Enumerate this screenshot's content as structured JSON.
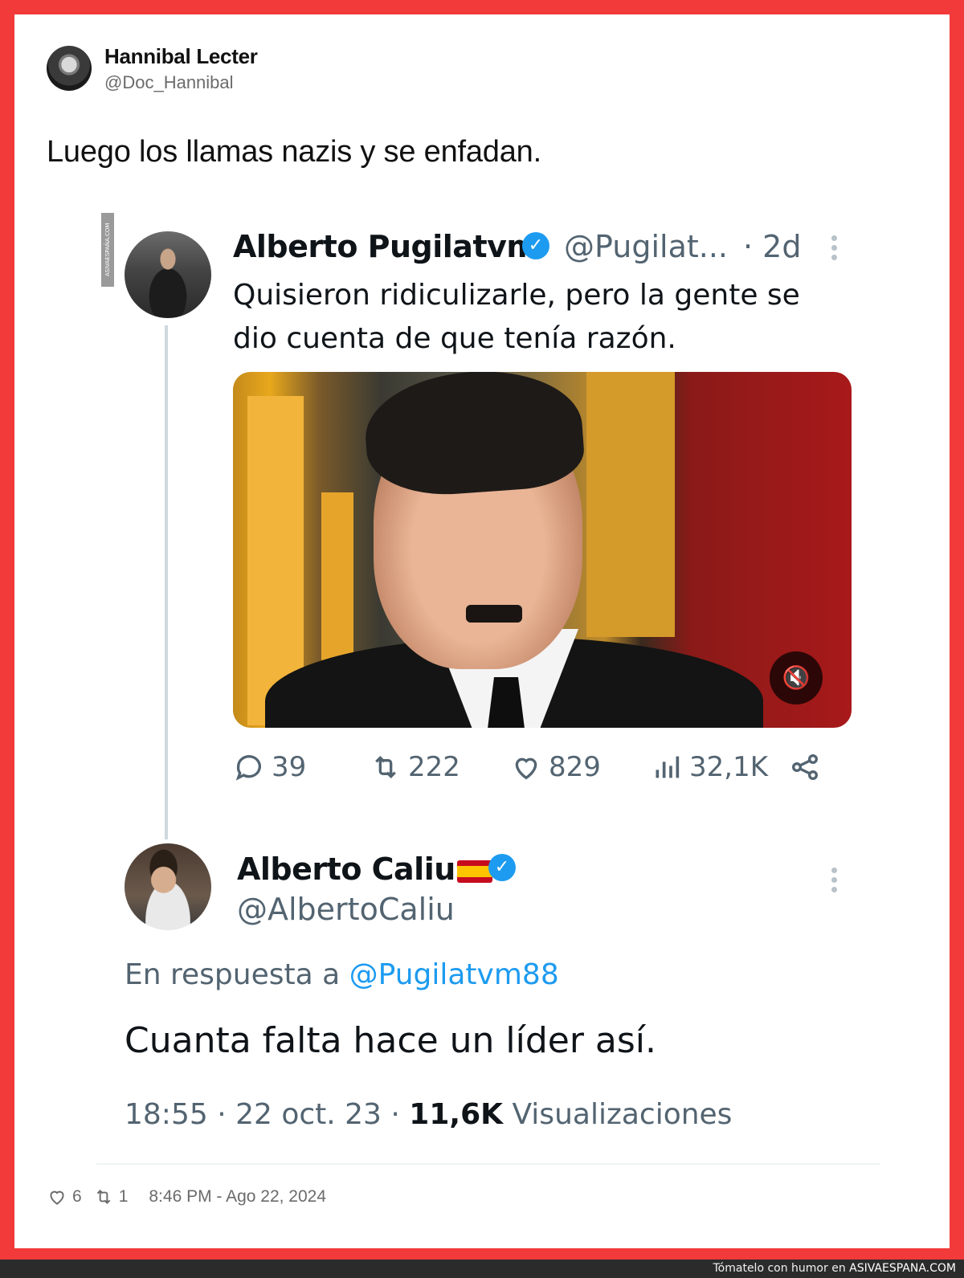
{
  "outer_tweet": {
    "author_name": "Hannibal Lecter",
    "author_handle": "@Doc_Hannibal",
    "text": "Luego los llamas nazis y se enfadan.",
    "likes": "6",
    "retweets": "1",
    "timestamp": "8:46 PM - Ago 22, 2024"
  },
  "quoted_tweet": {
    "author_name": "Alberto Pugilatvm",
    "author_handle": "@Pugilat...",
    "age": "· 2d",
    "text": "Quisieron ridiculizarle, pero la gente se dio cuenta de que tenía razón.",
    "stats": {
      "replies": "39",
      "retweets": "222",
      "likes": "829",
      "views": "32,1K"
    }
  },
  "reply_tweet": {
    "author_name": "Alberto Caliu",
    "author_handle": "@AlbertoCaliu",
    "reply_prefix": "En respuesta a",
    "reply_mention": "@Pugilatvm88",
    "text": "Cuanta falta hace un líder así.",
    "time": "18:55 · 22 oct. 23 ·",
    "views_count": "11,6K",
    "views_label": "Visualizaciones"
  },
  "watermark": "ASIVAESPAÑA.COM",
  "footer": {
    "prefix": "Tómatelo con humor en",
    "brand": "ASIVAESPANA.COM"
  },
  "colors": {
    "frame_border": "#f23a3a",
    "verified_blue": "#1d9bf0",
    "muted_text": "#536471"
  },
  "icons": [
    "verified-badge-icon",
    "more-dots-icon",
    "mute-icon",
    "reply-icon",
    "retweet-icon",
    "heart-icon",
    "views-icon",
    "share-icon"
  ]
}
